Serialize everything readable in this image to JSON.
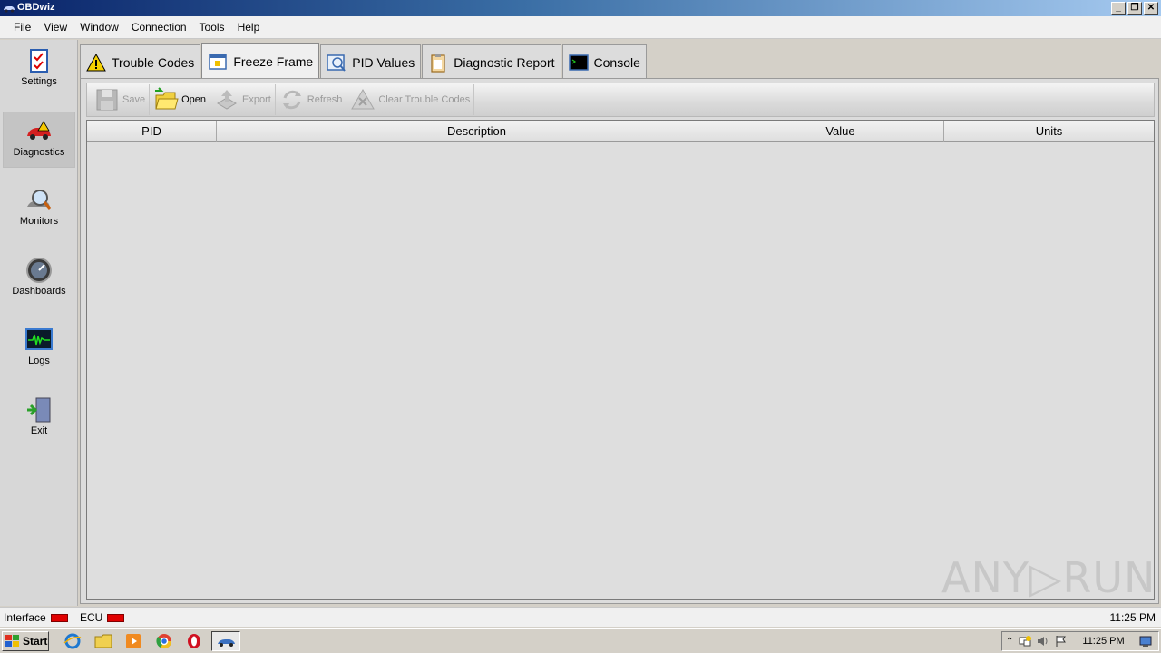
{
  "window": {
    "title": "OBDwiz",
    "buttons": [
      "_",
      "❐",
      "✕"
    ]
  },
  "menu": [
    "File",
    "View",
    "Window",
    "Connection",
    "Tools",
    "Help"
  ],
  "nav": [
    {
      "label": "Settings",
      "icon": "checklist-icon",
      "active": false
    },
    {
      "label": "Diagnostics",
      "icon": "car-warning-icon",
      "active": true
    },
    {
      "label": "Monitors",
      "icon": "magnifier-car-icon",
      "active": false
    },
    {
      "label": "Dashboards",
      "icon": "gauge-icon",
      "active": false
    },
    {
      "label": "Logs",
      "icon": "waveform-icon",
      "active": false
    },
    {
      "label": "Exit",
      "icon": "exit-door-icon",
      "active": false
    }
  ],
  "tabs": [
    {
      "label": "Trouble Codes",
      "icon": "warning-icon",
      "active": false
    },
    {
      "label": "Freeze Frame",
      "icon": "calendar-icon",
      "active": true
    },
    {
      "label": "PID Values",
      "icon": "magnifier-chart-icon",
      "active": false
    },
    {
      "label": "Diagnostic Report",
      "icon": "clipboard-icon",
      "active": false
    },
    {
      "label": "Console",
      "icon": "terminal-icon",
      "active": false
    }
  ],
  "toolbar": {
    "save": "Save",
    "open": "Open",
    "export": "Export",
    "refresh": "Refresh",
    "clear": "Clear Trouble Codes"
  },
  "grid": {
    "columns": [
      "PID",
      "Description",
      "Value",
      "Units"
    ],
    "rows": []
  },
  "status": {
    "interface": "Interface",
    "ecu": "ECU",
    "time": "11:25 PM",
    "led_color": "#e00000"
  },
  "taskbar": {
    "start": "Start",
    "clock": "11:25 PM"
  },
  "watermark": "ANY▷RUN"
}
